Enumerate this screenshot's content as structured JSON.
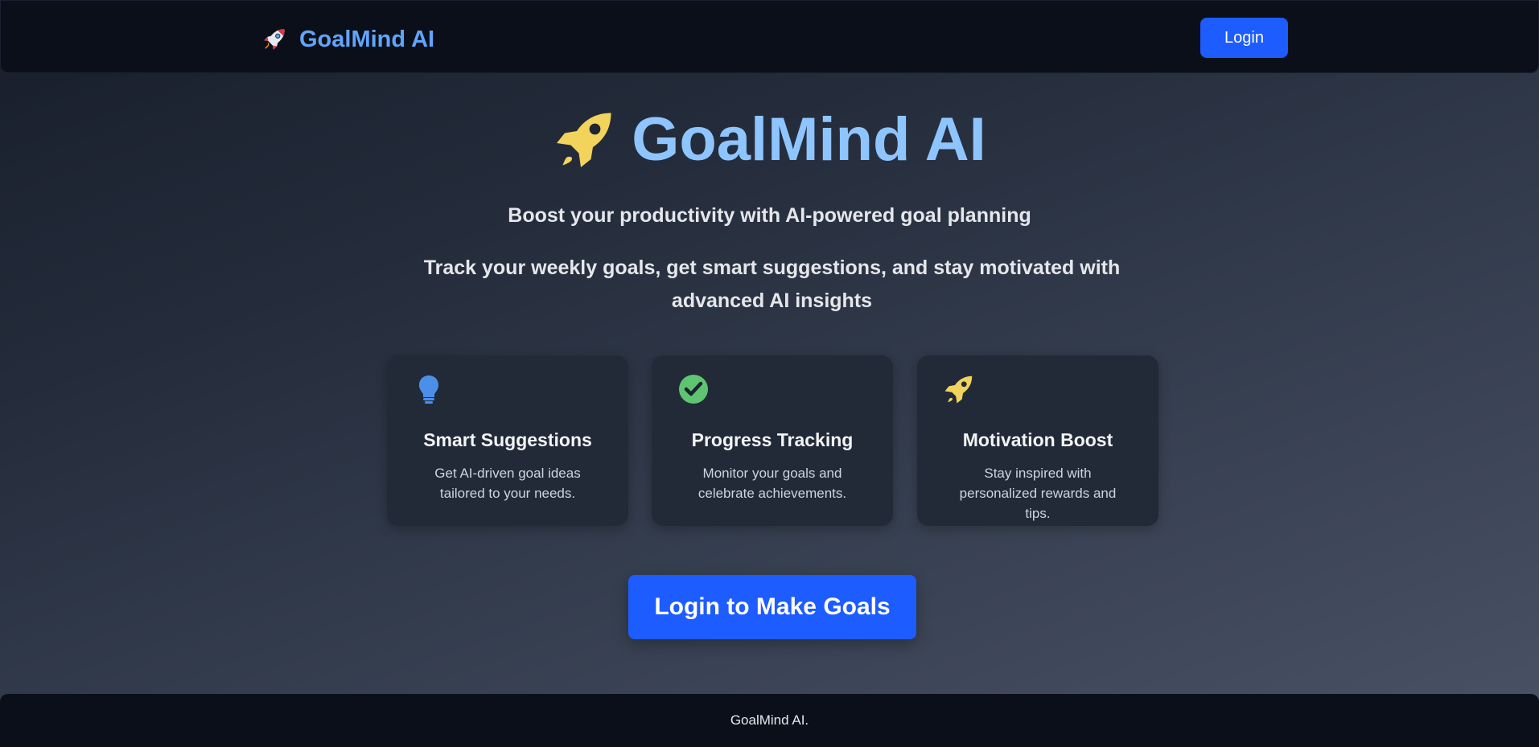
{
  "navbar": {
    "brand_icon": "rocket-icon",
    "brand_text": "GoalMind AI",
    "login_label": "Login"
  },
  "hero": {
    "icon": "rocket-icon",
    "title": "GoalMind AI",
    "tagline": "Boost your productivity with AI-powered goal planning",
    "subtext": "Track your weekly goals, get smart suggestions, and stay motivated with advanced AI insights"
  },
  "features": [
    {
      "icon": "lightbulb-icon",
      "title": "Smart Suggestions",
      "description": "Get AI-driven goal ideas tailored to your needs."
    },
    {
      "icon": "check-circle-icon",
      "title": "Progress Tracking",
      "description": "Monitor your goals and celebrate achievements."
    },
    {
      "icon": "rocket-icon",
      "title": "Motivation Boost",
      "description": "Stay inspired with personalized rewards and tips."
    }
  ],
  "cta": {
    "label": "Login to Make Goals"
  },
  "footer": {
    "text": "GoalMind AI."
  },
  "colors": {
    "accent": "#1d5cff",
    "brand": "#60a5fa",
    "hero_title": "#8ec5ff",
    "rocket": "#f2d45c",
    "check": "#5fc472",
    "bulb": "#4c8fe8",
    "nav_bg": "#0b0f1a",
    "card_bg": "#222a38"
  }
}
